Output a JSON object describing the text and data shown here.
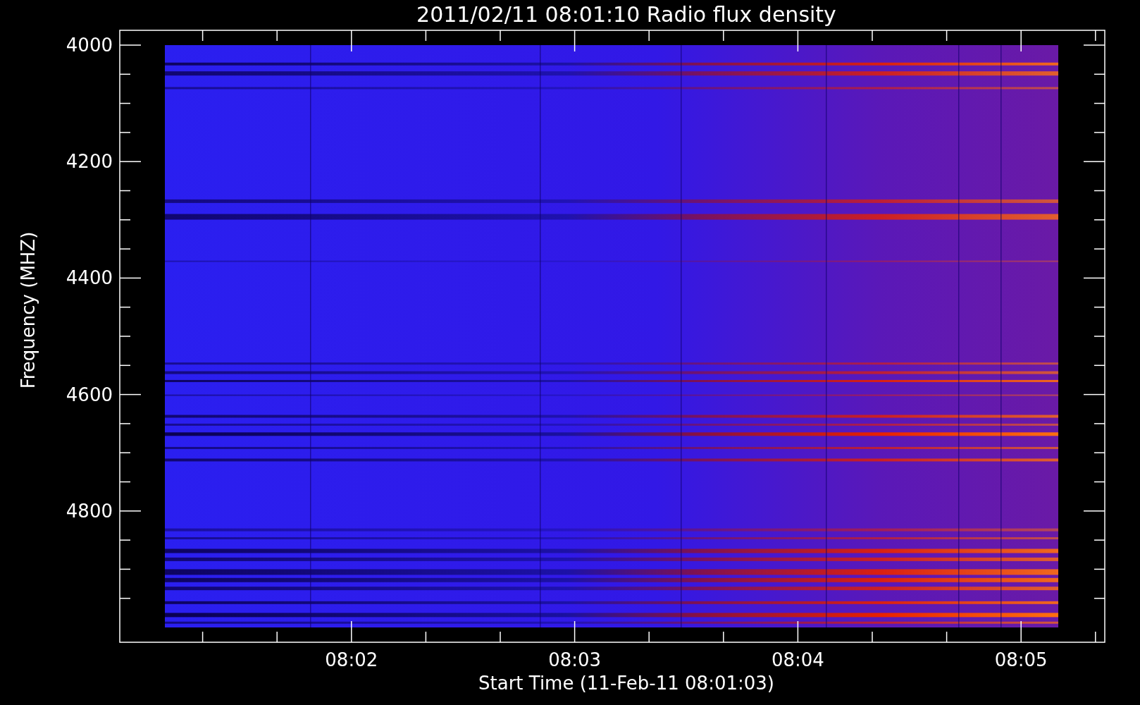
{
  "title": "2011/02/11 08:01:10 Radio flux density",
  "y_axis": {
    "title": "Frequency (MHZ)",
    "tick_labels": [
      "4000",
      "4200",
      "4400",
      "4600",
      "4800"
    ]
  },
  "x_axis": {
    "title": "Start Time (11-Feb-11 08:01:03)",
    "tick_labels": [
      "08:02",
      "08:03",
      "08:04",
      "08:05"
    ]
  }
}
